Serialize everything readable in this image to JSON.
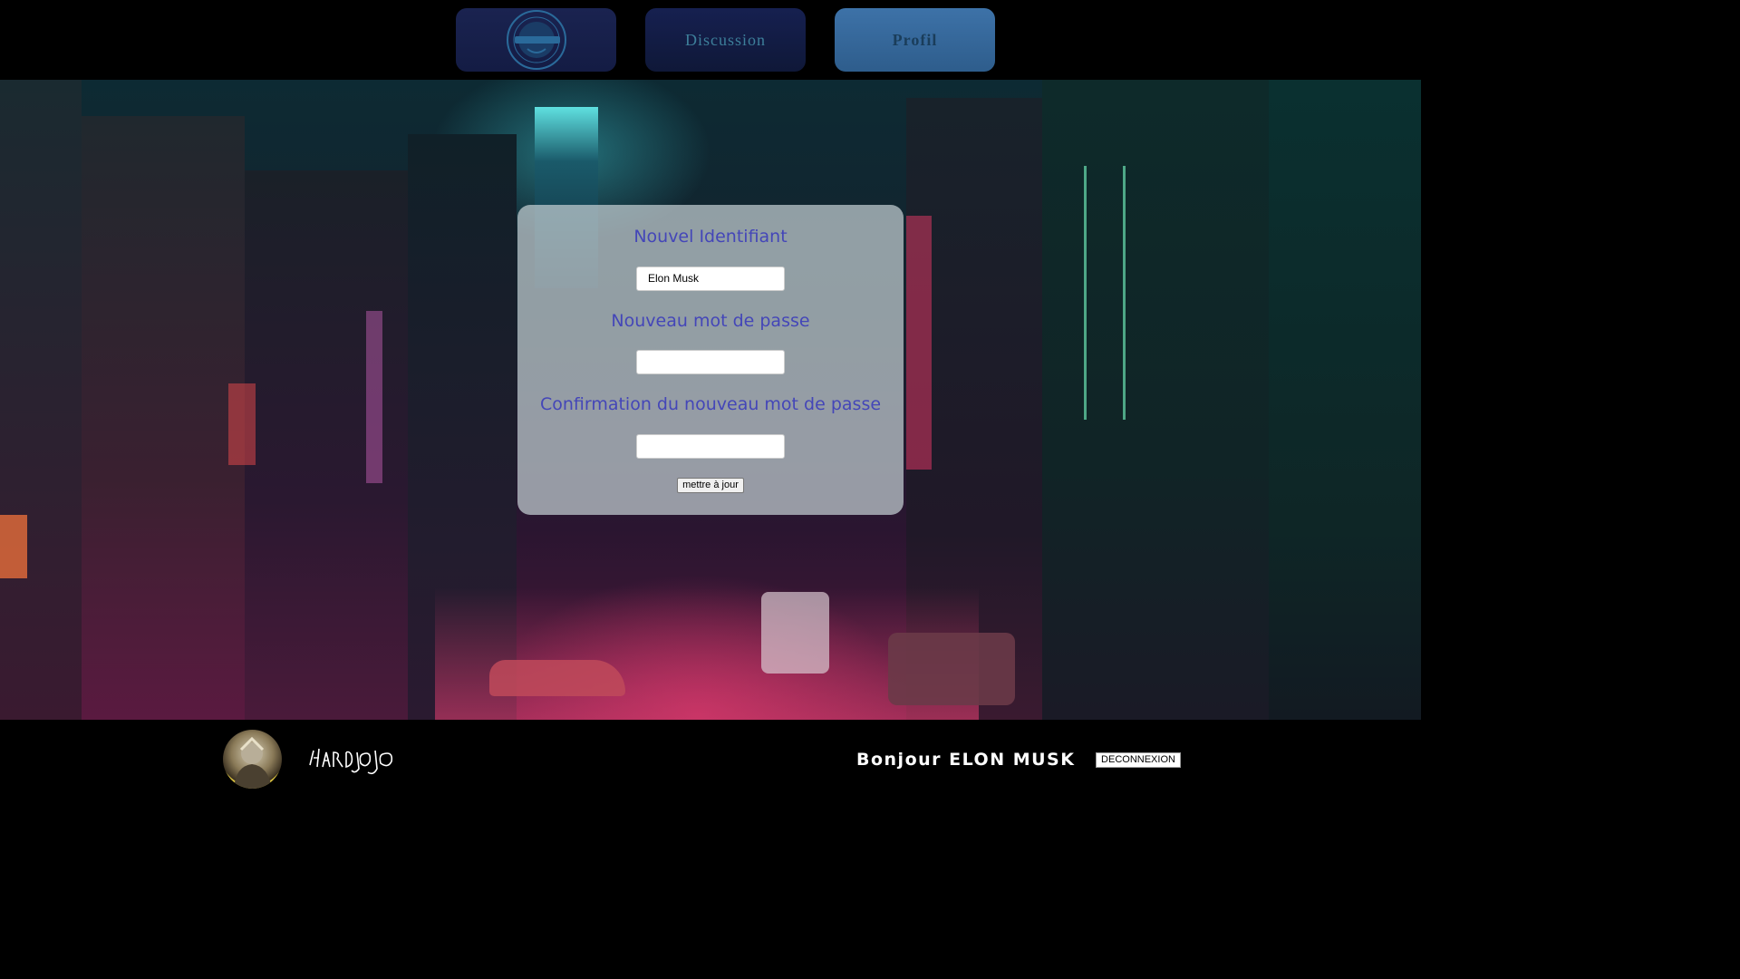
{
  "nav": {
    "logo_icon": "laughing-man-logo-icon",
    "discussion_label": "Discussion",
    "profile_label": "Profil",
    "colors": {
      "active": "#3d72a8",
      "inactive": "#141c44"
    }
  },
  "form": {
    "username_label": "Nouvel Identifiant",
    "username_value": "Elon Musk",
    "password_label": "Nouveau mot de passe",
    "password_value": "",
    "confirm_label": "Confirmation du nouveau mot de passe",
    "confirm_value": "",
    "submit_label": "mettre à jour",
    "label_color": "#4446b8"
  },
  "footer": {
    "avatar_icon": "user-avatar-icon",
    "signature_icon": "hardjojo-signature-logo",
    "greeting": "Bonjour ELON MUSK",
    "logout_label": "DECONNEXION"
  }
}
